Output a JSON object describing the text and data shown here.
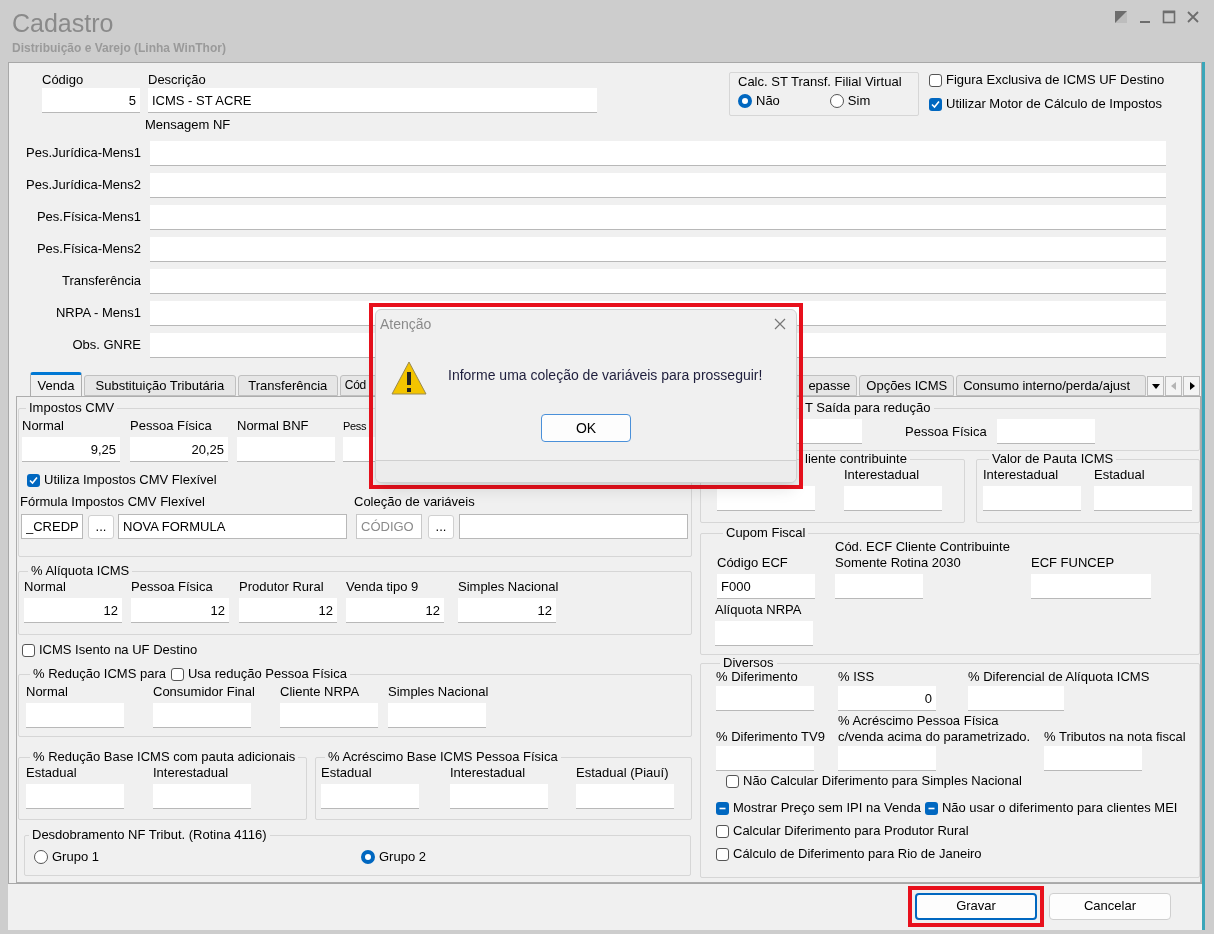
{
  "window": {
    "title": "Cadastro",
    "subtitle": "Distribuição e Varejo (Linha WinThor)"
  },
  "header": {
    "codigo": {
      "label": "Código",
      "value": "5"
    },
    "descricao": {
      "label": "Descrição",
      "value": "ICMS - ST ACRE"
    },
    "calc_st": {
      "title": "Calc. ST Transf. Filial Virtual",
      "options": [
        {
          "label": "Não",
          "selected": true
        },
        {
          "label": "Sim",
          "selected": false
        }
      ]
    },
    "checkboxes": [
      {
        "label": "Figura Exclusiva de ICMS UF Destino",
        "checked": false
      },
      {
        "label": "Utilizar Motor de Cálculo de Impostos",
        "checked": true
      }
    ],
    "mensagem_title": "Mensagem NF",
    "message_fields": [
      {
        "label": "Pes.Jurídica-Mens1"
      },
      {
        "label": "Pes.Jurídica-Mens2"
      },
      {
        "label": "Pes.Física-Mens1"
      },
      {
        "label": "Pes.Física-Mens2"
      },
      {
        "label": "Transferência"
      },
      {
        "label": "NRPA - Mens1"
      },
      {
        "label": "Obs. GNRE"
      }
    ]
  },
  "tabs": [
    {
      "label": "Venda",
      "selected": true
    },
    {
      "label": "Substituição Tributária",
      "selected": false
    },
    {
      "label": "Transferência",
      "selected": false
    },
    {
      "label": "Cód",
      "selected": false
    },
    {
      "label": "epasse",
      "selected": false
    },
    {
      "label": "Opções ICMS",
      "selected": false
    },
    {
      "label": "Consumo interno/perda/ajust",
      "selected": false
    }
  ],
  "venda": {
    "impostos_cmv": {
      "title": "Impostos CMV",
      "fields": [
        {
          "label": "Normal",
          "value": "9,25"
        },
        {
          "label": "Pessoa Física",
          "value": "20,25"
        },
        {
          "label": "Normal BNF"
        },
        {
          "label": "Pess"
        }
      ],
      "flexivel": {
        "label": "Utiliza Impostos CMV Flexível",
        "checked": true
      },
      "formula": {
        "label": "Fórmula Impostos CMV Flexível",
        "code": "_CREDP",
        "button": "...",
        "name": "NOVA FORMULA"
      },
      "colecao": {
        "label": "Coleção de variáveis",
        "placeholder": "CÓDIGO",
        "button": "..."
      }
    },
    "aliquota": {
      "title": "% Alíquota ICMS",
      "fields": [
        {
          "label": "Normal",
          "value": "12"
        },
        {
          "label": "Pessoa Física",
          "value": "12"
        },
        {
          "label": "Produtor Rural",
          "value": "12"
        },
        {
          "label": "Venda tipo 9",
          "value": "12"
        },
        {
          "label": "Simples Nacional",
          "value": "12"
        }
      ]
    },
    "isento": {
      "label": "ICMS Isento na UF Destino",
      "checked": false
    },
    "reducao": {
      "title": "% Redução ICMS para",
      "option": {
        "label": "Usa redução Pessoa Física",
        "checked": false
      },
      "fields": [
        {
          "label": "Normal"
        },
        {
          "label": "Consumidor Final"
        },
        {
          "label": "Cliente NRPA"
        },
        {
          "label": "Simples Nacional"
        }
      ]
    },
    "reducao_base": {
      "title": "% Redução Base ICMS com pauta adicionais",
      "fields": [
        {
          "label": "Estadual"
        },
        {
          "label": "Interestadual"
        }
      ]
    },
    "acrescimo_base": {
      "title": "% Acréscimo Base ICMS Pessoa Física",
      "fields": [
        {
          "label": "Estadual"
        },
        {
          "label": "Interestadual"
        },
        {
          "label": "Estadual (Piauí)"
        }
      ]
    },
    "desdobramento": {
      "title": "Desdobramento NF Tribut. (Rotina 4116)",
      "options": [
        {
          "label": "Grupo 1",
          "selected": false
        },
        {
          "label": "Grupo 2",
          "selected": true
        }
      ]
    },
    "st_saida": {
      "title": "T Saída para redução",
      "fields": [
        {
          "label": "Pessoa Física"
        }
      ]
    },
    "cliente_contribuinte": {
      "title": "liente contribuinte",
      "fields": [
        {
          "label": "Interestadual"
        }
      ]
    },
    "valor_pauta": {
      "title": "Valor de Pauta ICMS",
      "fields": [
        {
          "label": "Interestadual"
        },
        {
          "label": "Estadual"
        }
      ]
    },
    "cupom": {
      "title": "Cupom Fiscal",
      "codigo_ecf": {
        "label": "Código ECF",
        "value": "F000"
      },
      "cod_ecf_cliente": {
        "label_lines": [
          "Cód. ECF Cliente Contribuinte",
          "Somente Rotina 2030"
        ]
      },
      "ecf_funcep": {
        "label": "ECF FUNCEP"
      },
      "aliquota_nrpa": {
        "label": "Alíquota NRPA"
      }
    },
    "diversos": {
      "title": "Diversos",
      "fields": [
        {
          "label_lines": [
            "% Diferimento"
          ]
        },
        {
          "label_lines": [
            "% ISS"
          ],
          "value": "0"
        },
        {
          "label_lines": [
            "% Diferencial de Alíquota ICMS"
          ]
        },
        {
          "label_lines": [
            "% Diferimento TV9"
          ]
        },
        {
          "label_lines": [
            "% Acréscimo Pessoa Física",
            "c/venda acima do parametrizado."
          ]
        },
        {
          "label_lines": [
            "% Tributos na nota fiscal"
          ]
        }
      ],
      "checkboxes": [
        {
          "label": "Não Calcular Diferimento para Simples Nacional",
          "checked": false,
          "indeterminate": false
        },
        {
          "label": "Mostrar Preço sem IPI na Venda",
          "indeterminate": true
        },
        {
          "label": "Não usar o diferimento para clientes MEI",
          "indeterminate": true
        },
        {
          "label": "Calcular Diferimento para Produtor Rural",
          "checked": false,
          "indeterminate": false
        },
        {
          "label": "Cálculo de Diferimento para Rio de Janeiro",
          "checked": false,
          "indeterminate": false
        }
      ]
    }
  },
  "dialog": {
    "title": "Atenção",
    "message": "Informe uma coleção de variáveis para prosseguir!",
    "button": "OK",
    "highlighted": true
  },
  "buttons": [
    {
      "label": "Gravar",
      "highlighted": true
    },
    {
      "label": "Cancelar",
      "highlighted": false
    }
  ]
}
